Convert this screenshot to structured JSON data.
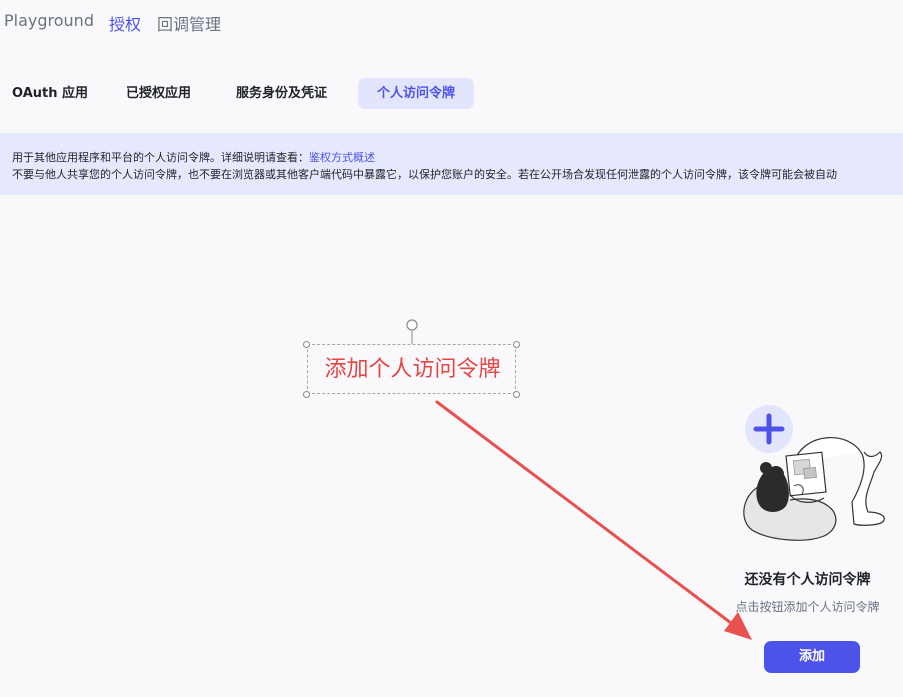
{
  "top_nav": {
    "items": [
      {
        "label": "Playground",
        "active": false
      },
      {
        "label": "授权",
        "active": true
      },
      {
        "label": "回调管理",
        "active": false
      }
    ]
  },
  "tabs": [
    {
      "label": "OAuth 应用",
      "active": false
    },
    {
      "label": "已授权应用",
      "active": false
    },
    {
      "label": "服务身份及凭证",
      "active": false
    },
    {
      "label": "个人访问令牌",
      "active": true
    }
  ],
  "notice": {
    "line1_prefix": "用于其他应用程序和平台的个人访问令牌。详细说明请查看：",
    "line1_link": "鉴权方式概述",
    "line2": "不要与他人共享您的个人访问令牌，也不要在浏览器或其他客户端代码中暴露它，以保护您账户的安全。若在公开场合发现任何泄露的个人访问令牌，该令牌可能会被自动"
  },
  "annotation": {
    "text": "添加个人访问令牌",
    "color": "#e64545"
  },
  "empty_state": {
    "title": "还没有个人访问令牌",
    "description": "点击按钮添加个人访问令牌",
    "add_button_label": "添加"
  },
  "colors": {
    "accent": "#4d53e8",
    "notice_background": "#e6e8fe",
    "active_tab_background": "#e3e5fd",
    "annotation_red": "#e64545"
  },
  "icons": {
    "illustration": "person-with-laptop-plus-icon",
    "annotation_arrow": "red-arrow"
  }
}
